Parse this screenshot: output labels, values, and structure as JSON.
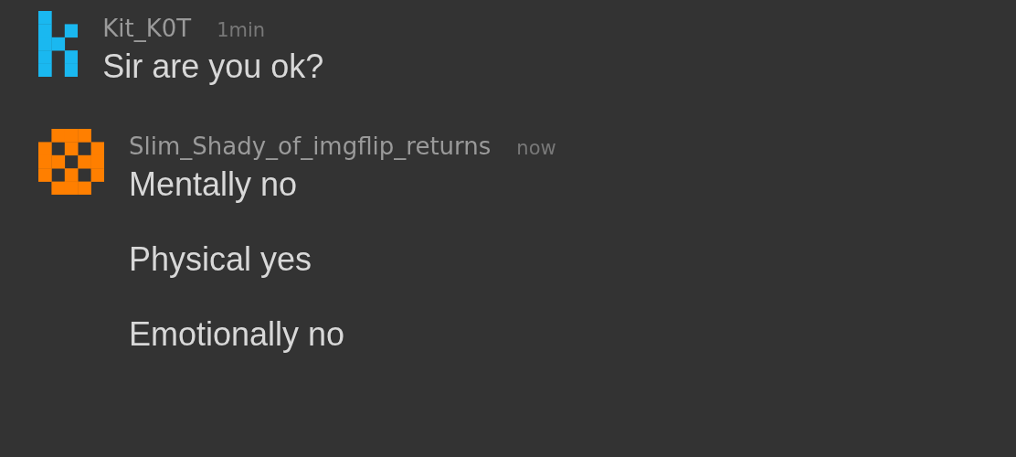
{
  "comments": [
    {
      "username": "Kit_K0T",
      "time": "1min",
      "color": "#1ab8f0",
      "lines": [
        "Sir are you ok?"
      ]
    },
    {
      "username": "Slim_Shady_of_imgflip_returns",
      "time": "now",
      "color": "#ff7f00",
      "lines": [
        "Mentally no",
        "Physical yes",
        "Emotionally no"
      ]
    }
  ]
}
